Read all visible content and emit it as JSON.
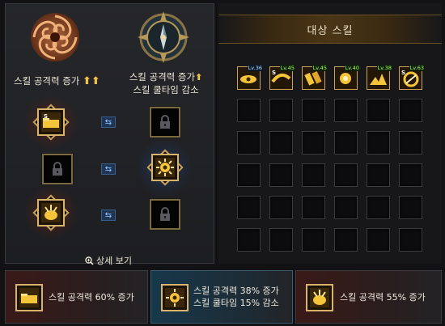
{
  "left": {
    "header_left": {
      "label": "스킬 공격력 증가",
      "arrows": "⬆⬆",
      "emblem": "red-swirl-emblem"
    },
    "header_right": {
      "label_line1": "스킬 공격력 증가",
      "arrow": "⬆",
      "label_line2": "스킬 쿨타임 감소",
      "emblem": "compass-emblem"
    },
    "rows": [
      {
        "left": "skill-active",
        "right": "locked"
      },
      {
        "left": "locked",
        "right": "skill-active"
      },
      {
        "left": "skill-active",
        "right": "locked"
      }
    ],
    "swap_symbol": "⇆",
    "detail_link": "상세 보기"
  },
  "right": {
    "title": "대상 스킬",
    "top_skills": [
      {
        "level": "Lv.36",
        "badge": "blue"
      },
      {
        "level": "Lv.45",
        "badge": "green",
        "prefix": "S"
      },
      {
        "level": "Lv.45",
        "badge": "green"
      },
      {
        "level": "Lv.40",
        "badge": "green"
      },
      {
        "level": "Lv.38",
        "badge": "green"
      },
      {
        "level": "Lv.63",
        "badge": "green",
        "prefix": "S"
      }
    ],
    "empty_rows": 5,
    "columns": 6
  },
  "bottom": [
    {
      "line1": "스킬 공격력 60% 증가",
      "line2": "",
      "theme": "red"
    },
    {
      "line1": "스킬 공격력 38% 증가",
      "line2": "스킬 쿨타임 15% 감소",
      "theme": "blue"
    },
    {
      "line1": "스킬 공격력 55% 증가",
      "line2": "",
      "theme": "red"
    }
  ],
  "colors": {
    "gold": "#d7b46a",
    "accent_blue": "#3a5e8c",
    "accent_red": "#7a2a22"
  }
}
